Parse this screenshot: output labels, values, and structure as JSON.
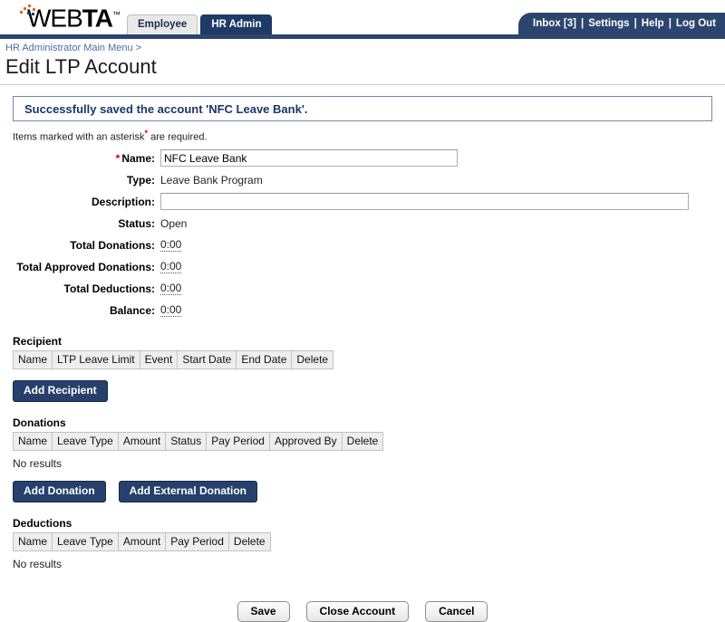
{
  "header": {
    "logo_text_light": "WEB",
    "logo_text_bold": "TA",
    "logo_tm": "™",
    "tabs": [
      {
        "label": "Employee",
        "active": false
      },
      {
        "label": "HR Admin",
        "active": true
      }
    ],
    "topnav": {
      "inbox": "Inbox [3]",
      "settings": "Settings",
      "help": "Help",
      "logout": "Log Out",
      "separator": "|"
    }
  },
  "breadcrumb": "HR Administrator Main Menu >",
  "page_title": "Edit LTP Account",
  "banner": {
    "message": "Successfully saved the account 'NFC Leave Bank'."
  },
  "asterisk_note": {
    "before": "Items marked with an asterisk",
    "star": "*",
    "after": " are required."
  },
  "form": {
    "name": {
      "label": "Name:",
      "required_marker": "*",
      "value": "NFC Leave Bank",
      "placeholder": ""
    },
    "type": {
      "label": "Type:",
      "value": "Leave Bank Program"
    },
    "description": {
      "label": "Description:",
      "value": "",
      "placeholder": ""
    },
    "status": {
      "label": "Status:",
      "value": "Open"
    },
    "total_donations": {
      "label": "Total Donations:",
      "value": "0:00"
    },
    "total_approved_donations": {
      "label": "Total Approved Donations:",
      "value": "0:00"
    },
    "total_deductions": {
      "label": "Total Deductions:",
      "value": "0:00"
    },
    "balance": {
      "label": "Balance:",
      "value": "0:00"
    }
  },
  "recipient": {
    "title": "Recipient",
    "columns": [
      "Name",
      "LTP Leave Limit",
      "Event",
      "Start Date",
      "End Date",
      "Delete"
    ],
    "rows": [],
    "buttons": [
      {
        "label": "Add Recipient"
      }
    ]
  },
  "donations": {
    "title": "Donations",
    "columns": [
      "Name",
      "Leave Type",
      "Amount",
      "Status",
      "Pay Period",
      "Approved By",
      "Delete"
    ],
    "rows": [],
    "empty_text": "No results",
    "buttons": [
      {
        "label": "Add Donation"
      },
      {
        "label": "Add External Donation"
      }
    ]
  },
  "deductions": {
    "title": "Deductions",
    "columns": [
      "Name",
      "Leave Type",
      "Amount",
      "Pay Period",
      "Delete"
    ],
    "rows": [],
    "empty_text": "No results"
  },
  "footer_buttons": [
    {
      "label": "Save"
    },
    {
      "label": "Close Account"
    },
    {
      "label": "Cancel"
    }
  ],
  "colors": {
    "navy": "#2b456f",
    "navy_dark": "#1e3a66",
    "button_navy": "#26406b",
    "accent_orange": "#e8681a",
    "link_blue": "#4a6fa5",
    "required_red": "#cc0000",
    "banner_border": "#7189ae",
    "table_header_bg": "#eeeeee"
  }
}
